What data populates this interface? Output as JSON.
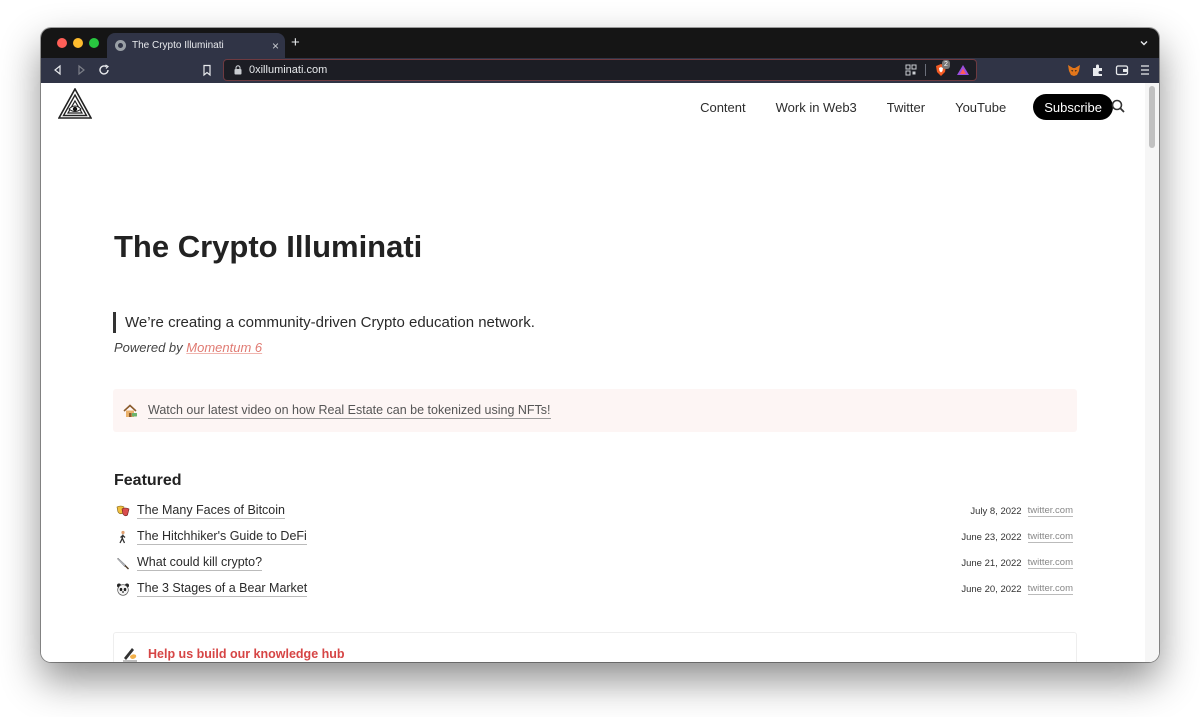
{
  "browser": {
    "tab_title": "The Crypto Illuminati",
    "tab_close": "×",
    "new_tab": "+",
    "url": "0xilluminati.com",
    "shields_badge": "2"
  },
  "site_nav": {
    "links": [
      "Content",
      "Work in Web3",
      "Twitter",
      "YouTube"
    ],
    "subscribe": "Subscribe"
  },
  "hero": {
    "title": "The Crypto Illuminati",
    "quote": "We’re creating a community-driven Crypto education network.",
    "powered_prefix": "Powered by ",
    "powered_link": "Momentum 6"
  },
  "callout": {
    "text": "Watch our latest video on how Real Estate can be tokenized using NFTs!"
  },
  "featured": {
    "heading": "Featured",
    "items": [
      {
        "title": "The Many Faces of Bitcoin",
        "date": "July 8, 2022",
        "source": "twitter.com"
      },
      {
        "title": "The Hitchhiker's Guide to DeFi",
        "date": "June 23, 2022",
        "source": "twitter.com"
      },
      {
        "title": "What could kill crypto?",
        "date": "June 21, 2022",
        "source": "twitter.com"
      },
      {
        "title": "The 3 Stages of a Bear Market",
        "date": "June 20, 2022",
        "source": "twitter.com"
      }
    ]
  },
  "help": {
    "text": "Help us build our knowledge hub"
  },
  "colors": {
    "accent_link": "#e07a72",
    "help_red": "#d64545",
    "callout_bg": "#fdf5f4",
    "chrome_dark": "#303446"
  }
}
